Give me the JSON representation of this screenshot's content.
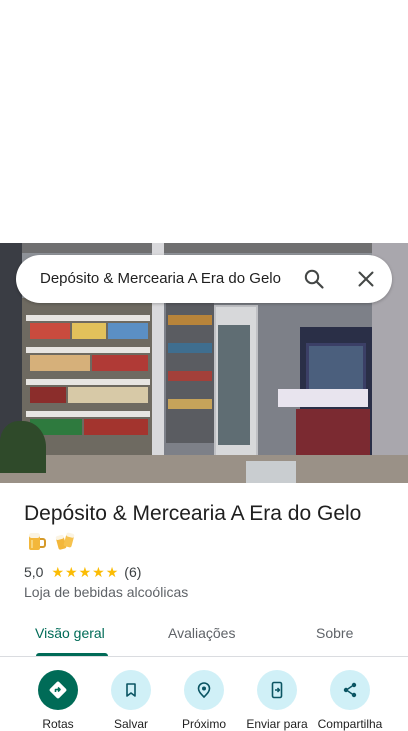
{
  "search": {
    "query": "Depósito & Mercearia A Era do Gelo"
  },
  "place": {
    "title": "Depósito & Mercearia A Era do Gelo",
    "rating": "5,0",
    "stars": 5,
    "review_count": "(6)",
    "category": "Loja de bebidas alcoólicas"
  },
  "tabs": [
    {
      "label": "Visão geral"
    },
    {
      "label": "Avaliações"
    },
    {
      "label": "Sobre"
    }
  ],
  "actions": [
    {
      "label": "Rotas",
      "icon": "directions-icon"
    },
    {
      "label": "Salvar",
      "icon": "bookmark-icon"
    },
    {
      "label": "Próximo",
      "icon": "nearby-icon"
    },
    {
      "label": "Enviar para",
      "icon": "send-to-phone-icon"
    },
    {
      "label": "Compartilha",
      "icon": "share-icon"
    }
  ],
  "colors": {
    "accent": "#006b57",
    "action_bg": "#d0f0f7",
    "star": "#fbbc04"
  }
}
